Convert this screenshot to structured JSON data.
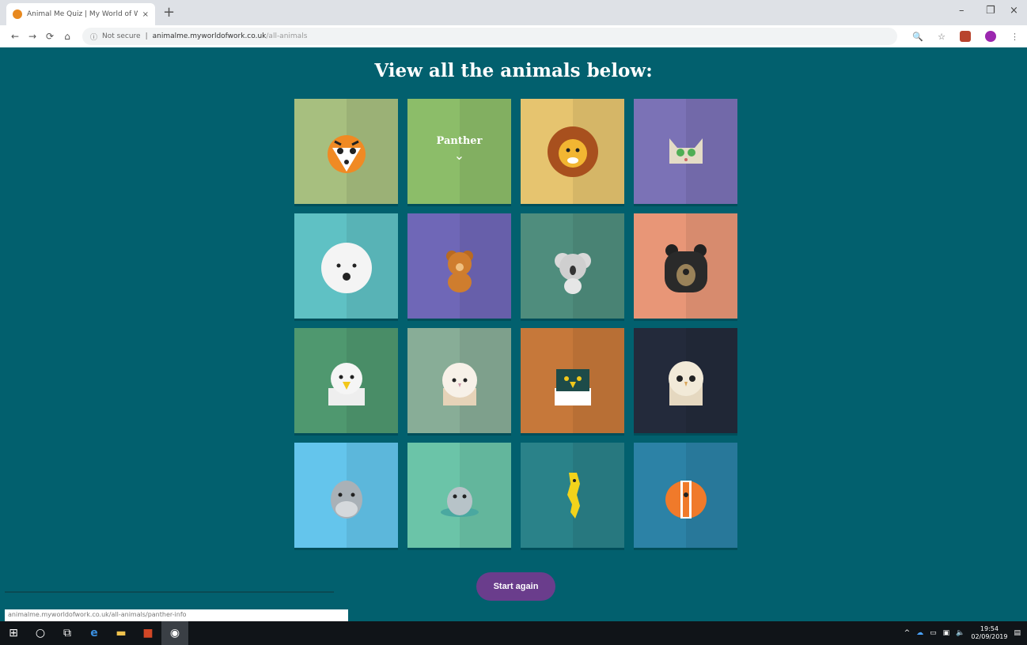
{
  "browser": {
    "tab_title": "Animal Me Quiz | My World of Work",
    "tab_close": "×",
    "new_tab": "+",
    "minimize": "–",
    "restore": "❐",
    "close": "×",
    "security": "Not secure",
    "url_host": "animalme.myworldofwork.co.uk",
    "url_path": "/all-animals"
  },
  "page": {
    "heading": "View all the animals below:",
    "hover_label": "Panther",
    "start_again": "Start again"
  },
  "animals": [
    {
      "icon": "tiger-icon",
      "bg": "#a7bf7f"
    },
    {
      "icon": "panther-icon",
      "bg": "#8cbd69"
    },
    {
      "icon": "lion-icon",
      "bg": "#e6c46f"
    },
    {
      "icon": "cat-icon",
      "bg": "#7b72b6"
    },
    {
      "icon": "polar-bear-icon",
      "bg": "#5fc1c4"
    },
    {
      "icon": "teddy-bear-icon",
      "bg": "#6f67b7"
    },
    {
      "icon": "koala-icon",
      "bg": "#4f8d7d"
    },
    {
      "icon": "black-bear-icon",
      "bg": "#e89677"
    },
    {
      "icon": "eagle-icon",
      "bg": "#4f986f"
    },
    {
      "icon": "barn-owl-icon",
      "bg": "#88ad97"
    },
    {
      "icon": "falcon-icon",
      "bg": "#c6783a"
    },
    {
      "icon": "owl-icon",
      "bg": "#232a3b"
    },
    {
      "icon": "dolphin-icon",
      "bg": "#64c5ec"
    },
    {
      "icon": "seal-icon",
      "bg": "#6bc4a8"
    },
    {
      "icon": "seahorse-icon",
      "bg": "#2a8289"
    },
    {
      "icon": "clownfish-icon",
      "bg": "#2c82a6"
    }
  ],
  "status_url": "animalme.myworldofwork.co.uk/all-animals/panther-info",
  "taskbar": {
    "time": "19:54",
    "date": "02/09/2019"
  }
}
